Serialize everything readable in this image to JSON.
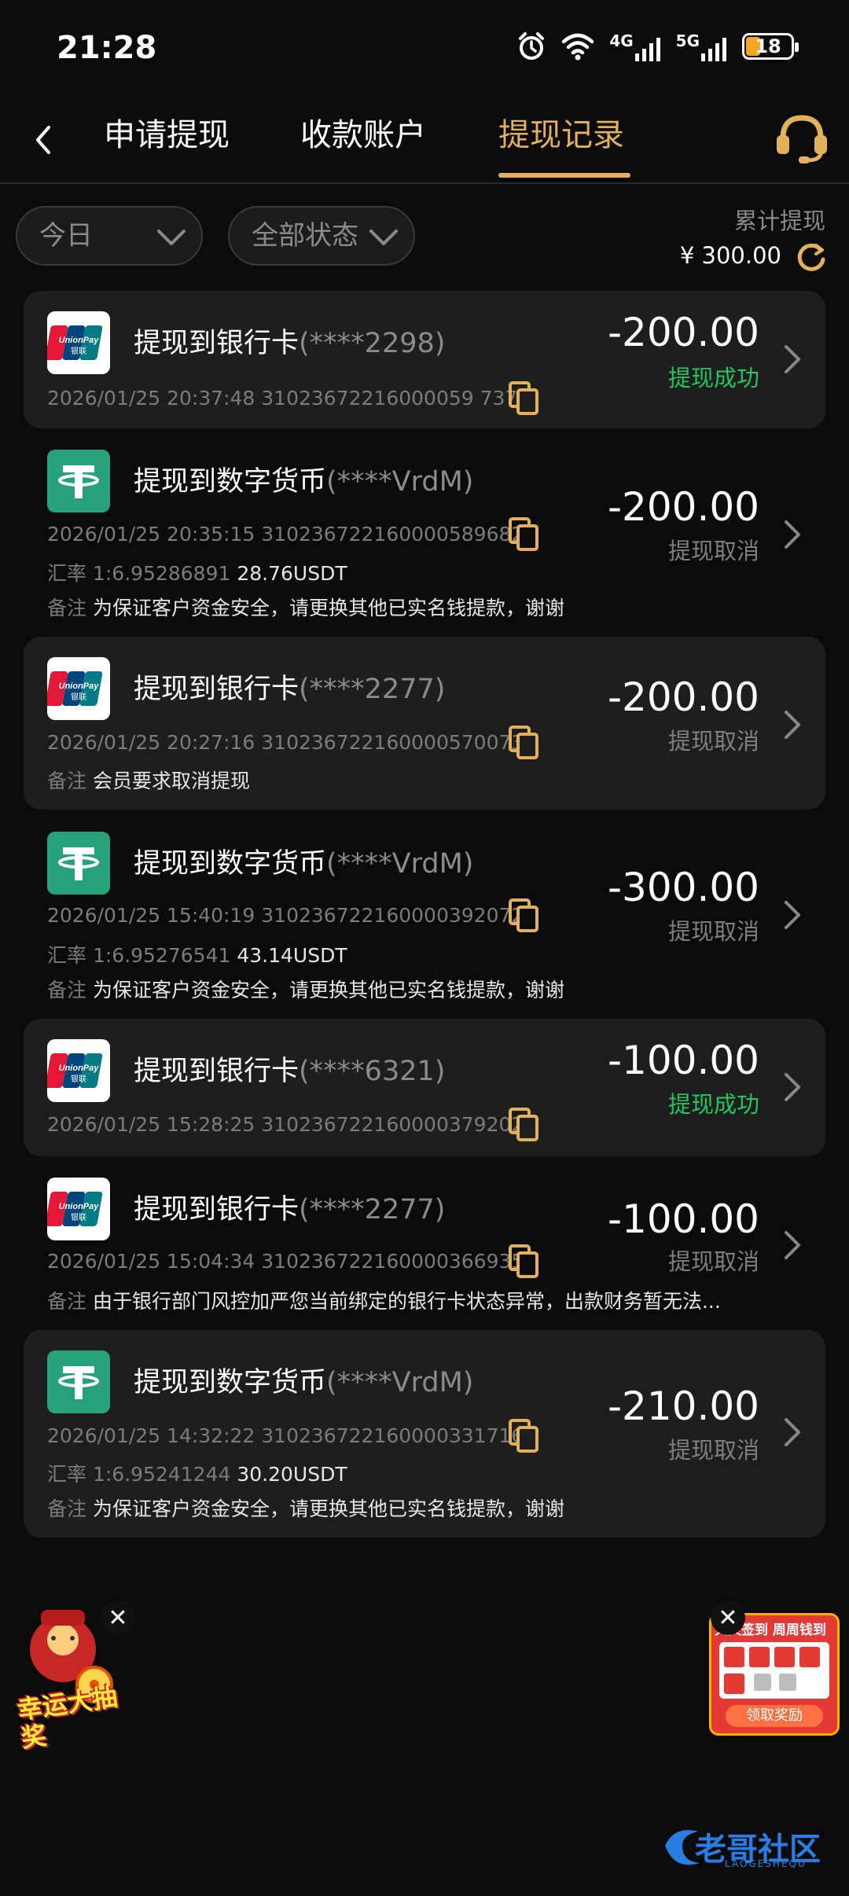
{
  "status_bar": {
    "time": "21:28",
    "net1": "4G",
    "net2": "5G",
    "battery": "18"
  },
  "nav": {
    "tabs": [
      {
        "label": "申请提现"
      },
      {
        "label": "收款账户"
      },
      {
        "label": "提现记录"
      }
    ]
  },
  "filters": {
    "date": "今日",
    "status": "全部状态",
    "total_label": "累计提现",
    "total_value": "¥ 300.00"
  },
  "records": [
    {
      "type": "unionpay",
      "title": "提现到银行卡",
      "account": "(****2298)",
      "meta": "2026/01/25 20:37:48 31023672216000059 7375",
      "amount": "-200.00",
      "status": "提现成功",
      "status_type": "ok"
    },
    {
      "type": "usdt",
      "title": "提现到数字货币",
      "account": "(****VrdM)",
      "meta": "2026/01/25 20:35:15 310236722160000589682",
      "rate_label": "汇率",
      "rate": "1:6.95286891",
      "rate_value": "28.76USDT",
      "note_label": "备注",
      "note": "为保证客户资金安全，请更换其他已实名钱提款，谢谢",
      "amount": "-200.00",
      "status": "提现取消",
      "status_type": "cancel"
    },
    {
      "type": "unionpay",
      "title": "提现到银行卡",
      "account": "(****2277)",
      "meta": "2026/01/25 20:27:16 310236722160000570073",
      "note_label": "备注",
      "note": "会员要求取消提现",
      "amount": "-200.00",
      "status": "提现取消",
      "status_type": "cancel"
    },
    {
      "type": "usdt",
      "title": "提现到数字货币",
      "account": "(****VrdM)",
      "meta": "2026/01/25 15:40:19 310236722160000392072",
      "rate_label": "汇率",
      "rate": "1:6.95276541",
      "rate_value": "43.14USDT",
      "note_label": "备注",
      "note": "为保证客户资金安全，请更换其他已实名钱提款，谢谢",
      "amount": "-300.00",
      "status": "提现取消",
      "status_type": "cancel"
    },
    {
      "type": "unionpay",
      "title": "提现到银行卡",
      "account": "(****6321)",
      "meta": "2026/01/25 15:28:25 310236722160000379202",
      "amount": "-100.00",
      "status": "提现成功",
      "status_type": "ok"
    },
    {
      "type": "unionpay",
      "title": "提现到银行卡",
      "account": "(****2277)",
      "meta": "2026/01/25 15:04:34 310236722160000366935",
      "note_label": "备注",
      "note": "由于银行部门风控加严您当前绑定的银行卡状态异常，出款财务暂无法...",
      "amount": "-100.00",
      "status": "提现取消",
      "status_type": "cancel"
    },
    {
      "type": "usdt",
      "title": "提现到数字货币",
      "account": "(****VrdM)",
      "meta": "2026/01/25 14:32:22 310236722160000331716",
      "rate_label": "汇率",
      "rate": "1:6.95241244",
      "rate_value": "30.20USDT",
      "note_label": "备注",
      "note": "为保证客户资金安全，请更换其他已实名钱提款，谢谢",
      "amount": "-210.00",
      "status": "提现取消",
      "status_type": "cancel"
    }
  ],
  "floating": {
    "left_text": "幸运大抽奖",
    "right_title": "天天签到 周周钱到",
    "right_button": "领取奖励"
  },
  "watermark": "老哥社区",
  "watermark_sub": "LAOGESHEQU",
  "colors": {
    "accent": "#e3b15a",
    "success": "#22c55e",
    "muted": "#7f7f7f",
    "usdt": "#26a17b"
  }
}
